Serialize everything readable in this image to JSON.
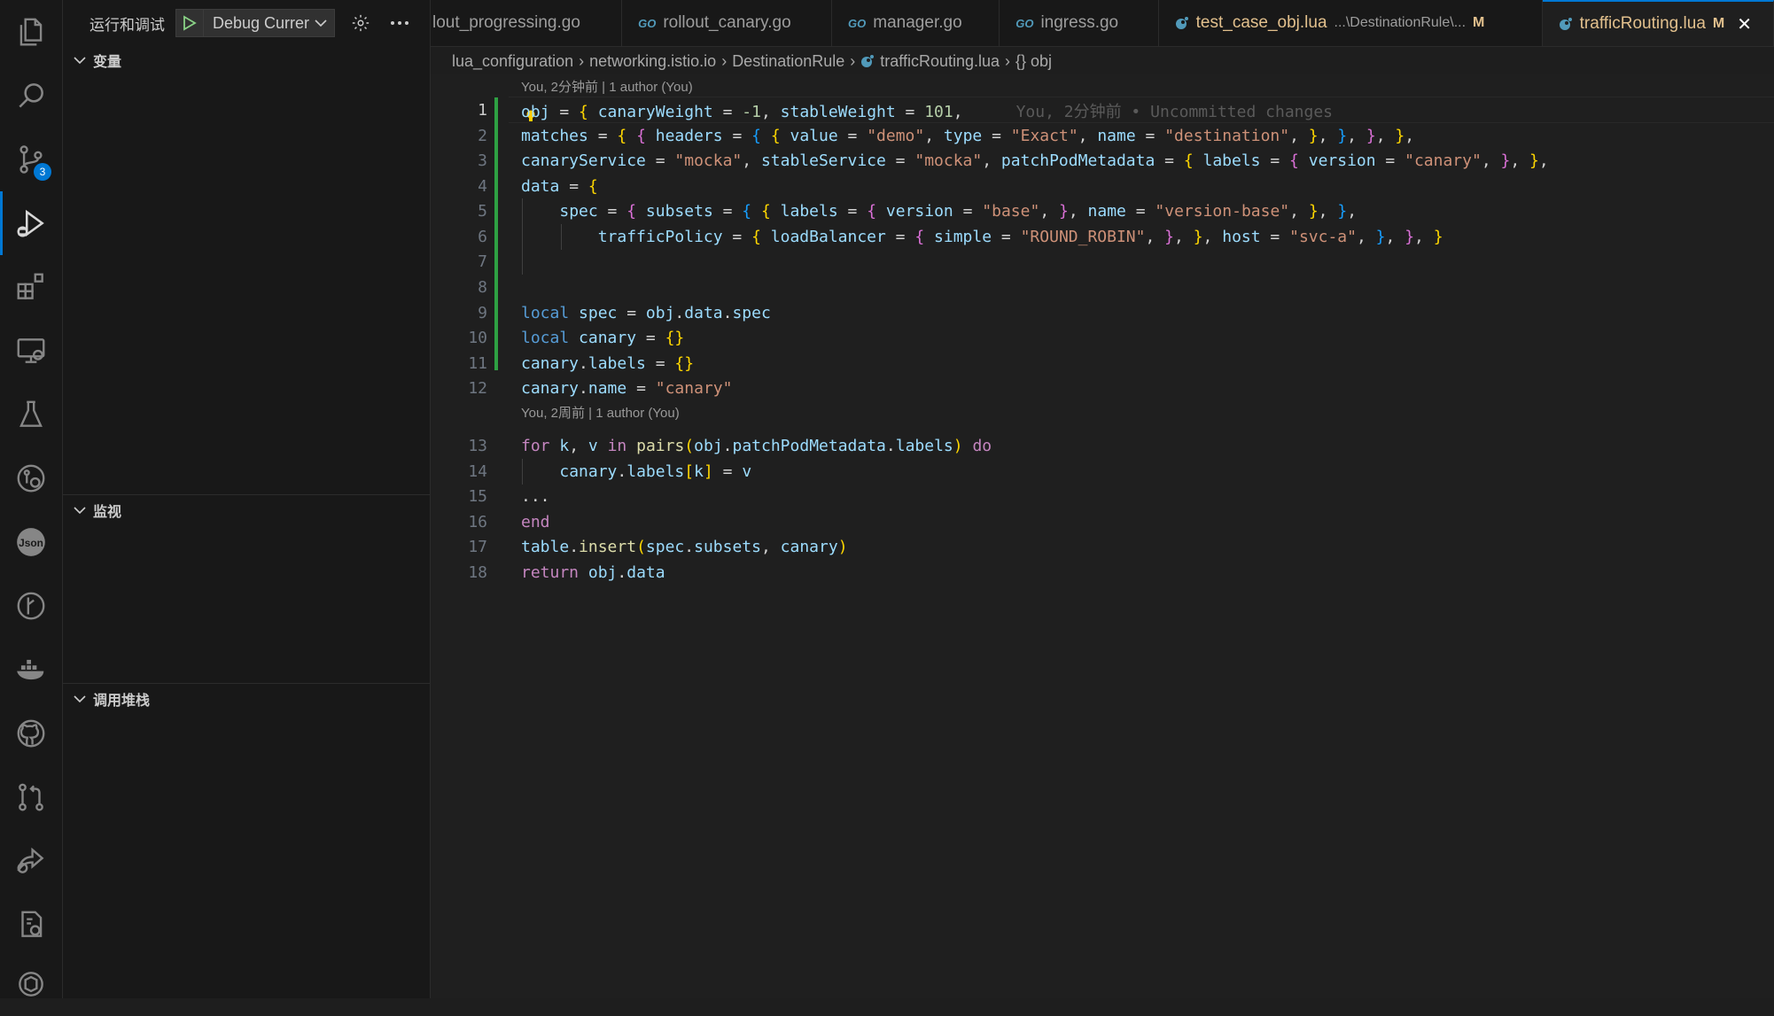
{
  "activity_bar": {
    "items": [
      {
        "icon": "explorer-icon"
      },
      {
        "icon": "search-icon"
      },
      {
        "icon": "source-control-icon",
        "badge": "3"
      },
      {
        "icon": "run-debug-icon",
        "active": true
      },
      {
        "icon": "extensions-icon"
      },
      {
        "icon": "remote-explorer-icon"
      },
      {
        "icon": "testing-icon"
      },
      {
        "icon": "gitlens-icon"
      },
      {
        "icon": "json-icon",
        "label": "Json"
      },
      {
        "icon": "git-graph-icon"
      },
      {
        "icon": "docker-icon"
      },
      {
        "icon": "github-icon"
      },
      {
        "icon": "pull-request-icon"
      },
      {
        "icon": "live-share-icon"
      },
      {
        "icon": "settings-sync-icon"
      },
      {
        "icon": "chatgpt-icon"
      }
    ]
  },
  "sidebar": {
    "title": "运行和调试",
    "config_label": "Debug Currer",
    "sections": {
      "variables": "变量",
      "watch": "监视",
      "call_stack": "调用堆栈"
    }
  },
  "tabs": [
    {
      "label": "lout_progressing.go",
      "kind": "plain"
    },
    {
      "label": "rollout_canary.go",
      "kind": "go"
    },
    {
      "label": "manager.go",
      "kind": "go"
    },
    {
      "label": "ingress.go",
      "kind": "go"
    },
    {
      "label": "test_case_obj.lua",
      "kind": "lua",
      "path": "...\\DestinationRule\\...",
      "modified": "M"
    },
    {
      "label": "trafficRouting.lua",
      "kind": "lua",
      "modified": "M",
      "active": true
    }
  ],
  "breadcrumb": [
    "lua_configuration",
    "networking.istio.io",
    "DestinationRule",
    "trafficRouting.lua",
    "{} obj"
  ],
  "editor": {
    "codelens_1": "You, 2分钟前 | 1 author (You)",
    "codelens_2": "You, 2周前 | 1 author (You)",
    "blame_line_1": "You, 2分钟前 • Uncommitted changes",
    "line_numbers": [
      "1",
      "2",
      "3",
      "4",
      "5",
      "6",
      "7",
      "8",
      "9",
      "10",
      "11",
      "12",
      "13",
      "14",
      "15",
      "16",
      "17",
      "18"
    ],
    "lines": [
      [
        [
          "v",
          "obj"
        ],
        [
          "p",
          " = "
        ],
        [
          "b1",
          "{"
        ],
        [
          "v",
          " canaryWeight"
        ],
        [
          "p",
          " = "
        ],
        [
          "n",
          "-1"
        ],
        [
          "p",
          ", "
        ],
        [
          "v",
          "stableWeight"
        ],
        [
          "p",
          " = "
        ],
        [
          "n",
          "101"
        ],
        [
          "p",
          ","
        ]
      ],
      [
        [
          "v",
          "matches"
        ],
        [
          "p",
          " = "
        ],
        [
          "b1",
          "{"
        ],
        [
          "p",
          " "
        ],
        [
          "b2",
          "{"
        ],
        [
          "p",
          " "
        ],
        [
          "v",
          "headers"
        ],
        [
          "p",
          " = "
        ],
        [
          "b3",
          "{"
        ],
        [
          "p",
          " "
        ],
        [
          "b1",
          "{"
        ],
        [
          "p",
          " "
        ],
        [
          "v",
          "value"
        ],
        [
          "p",
          " = "
        ],
        [
          "s",
          "\"demo\""
        ],
        [
          "p",
          ", "
        ],
        [
          "v",
          "type"
        ],
        [
          "p",
          " = "
        ],
        [
          "s",
          "\"Exact\""
        ],
        [
          "p",
          ", "
        ],
        [
          "v",
          "name"
        ],
        [
          "p",
          " = "
        ],
        [
          "s",
          "\"destination\""
        ],
        [
          "p",
          ", "
        ],
        [
          "b1",
          "}"
        ],
        [
          "p",
          ", "
        ],
        [
          "b3",
          "}"
        ],
        [
          "p",
          ", "
        ],
        [
          "b2",
          "}"
        ],
        [
          "p",
          ", "
        ],
        [
          "b1",
          "}"
        ],
        [
          "p",
          ","
        ]
      ],
      [
        [
          "v",
          "canaryService"
        ],
        [
          "p",
          " = "
        ],
        [
          "s",
          "\"mocka\""
        ],
        [
          "p",
          ", "
        ],
        [
          "v",
          "stableService"
        ],
        [
          "p",
          " = "
        ],
        [
          "s",
          "\"mocka\""
        ],
        [
          "p",
          ", "
        ],
        [
          "v",
          "patchPodMetadata"
        ],
        [
          "p",
          " = "
        ],
        [
          "b1",
          "{"
        ],
        [
          "p",
          " "
        ],
        [
          "v",
          "labels"
        ],
        [
          "p",
          " = "
        ],
        [
          "b2",
          "{"
        ],
        [
          "p",
          " "
        ],
        [
          "v",
          "version"
        ],
        [
          "p",
          " = "
        ],
        [
          "s",
          "\"canary\""
        ],
        [
          "p",
          ", "
        ],
        [
          "b2",
          "}"
        ],
        [
          "p",
          ", "
        ],
        [
          "b1",
          "}"
        ],
        [
          "p",
          ","
        ]
      ],
      [
        [
          "v",
          "data"
        ],
        [
          "p",
          " = "
        ],
        [
          "b1",
          "{"
        ]
      ],
      [
        [
          "p",
          "    "
        ],
        [
          "v",
          "spec"
        ],
        [
          "p",
          " = "
        ],
        [
          "b2",
          "{"
        ],
        [
          "p",
          " "
        ],
        [
          "v",
          "subsets"
        ],
        [
          "p",
          " = "
        ],
        [
          "b3",
          "{"
        ],
        [
          "p",
          " "
        ],
        [
          "b1",
          "{"
        ],
        [
          "p",
          " "
        ],
        [
          "v",
          "labels"
        ],
        [
          "p",
          " = "
        ],
        [
          "b2",
          "{"
        ],
        [
          "p",
          " "
        ],
        [
          "v",
          "version"
        ],
        [
          "p",
          " = "
        ],
        [
          "s",
          "\"base\""
        ],
        [
          "p",
          ", "
        ],
        [
          "b2",
          "}"
        ],
        [
          "p",
          ", "
        ],
        [
          "v",
          "name"
        ],
        [
          "p",
          " = "
        ],
        [
          "s",
          "\"version-base\""
        ],
        [
          "p",
          ", "
        ],
        [
          "b1",
          "}"
        ],
        [
          "p",
          ", "
        ],
        [
          "b3",
          "}"
        ],
        [
          "p",
          ","
        ]
      ],
      [
        [
          "p",
          "        "
        ],
        [
          "v",
          "trafficPolicy"
        ],
        [
          "p",
          " = "
        ],
        [
          "b1",
          "{"
        ],
        [
          "p",
          " "
        ],
        [
          "v",
          "loadBalancer"
        ],
        [
          "p",
          " = "
        ],
        [
          "b2",
          "{"
        ],
        [
          "p",
          " "
        ],
        [
          "v",
          "simple"
        ],
        [
          "p",
          " = "
        ],
        [
          "s",
          "\"ROUND_ROBIN\""
        ],
        [
          "p",
          ", "
        ],
        [
          "b2",
          "}"
        ],
        [
          "p",
          ", "
        ],
        [
          "b1",
          "}"
        ],
        [
          "p",
          ", "
        ],
        [
          "v",
          "host"
        ],
        [
          "p",
          " = "
        ],
        [
          "s",
          "\"svc-a\""
        ],
        [
          "p",
          ", "
        ],
        [
          "b3",
          "}"
        ],
        [
          "p",
          ", "
        ],
        [
          "b2",
          "}"
        ],
        [
          "p",
          ", "
        ],
        [
          "b1",
          "}"
        ]
      ],
      [],
      [],
      [
        [
          "k",
          "local"
        ],
        [
          "p",
          " "
        ],
        [
          "v",
          "spec"
        ],
        [
          "p",
          " = "
        ],
        [
          "v",
          "obj"
        ],
        [
          "p",
          "."
        ],
        [
          "v",
          "data"
        ],
        [
          "p",
          "."
        ],
        [
          "v",
          "spec"
        ]
      ],
      [
        [
          "k",
          "local"
        ],
        [
          "p",
          " "
        ],
        [
          "v",
          "canary"
        ],
        [
          "p",
          " = "
        ],
        [
          "b1",
          "{}"
        ]
      ],
      [
        [
          "v",
          "canary"
        ],
        [
          "p",
          "."
        ],
        [
          "v",
          "labels"
        ],
        [
          "p",
          " = "
        ],
        [
          "b1",
          "{}"
        ]
      ],
      [
        [
          "v",
          "canary"
        ],
        [
          "p",
          "."
        ],
        [
          "v",
          "name"
        ],
        [
          "p",
          " = "
        ],
        [
          "s",
          "\"canary\""
        ]
      ],
      [
        [
          "c",
          "for"
        ],
        [
          "p",
          " "
        ],
        [
          "v",
          "k"
        ],
        [
          "p",
          ", "
        ],
        [
          "v",
          "v"
        ],
        [
          "p",
          " "
        ],
        [
          "c",
          "in"
        ],
        [
          "p",
          " "
        ],
        [
          "f",
          "pairs"
        ],
        [
          "b1",
          "("
        ],
        [
          "v",
          "obj"
        ],
        [
          "p",
          "."
        ],
        [
          "v",
          "patchPodMetadata"
        ],
        [
          "p",
          "."
        ],
        [
          "v",
          "labels"
        ],
        [
          "b1",
          ")"
        ],
        [
          "p",
          " "
        ],
        [
          "c",
          "do"
        ]
      ],
      [
        [
          "p",
          "    "
        ],
        [
          "v",
          "canary"
        ],
        [
          "p",
          "."
        ],
        [
          "v",
          "labels"
        ],
        [
          "b1",
          "["
        ],
        [
          "v",
          "k"
        ],
        [
          "b1",
          "]"
        ],
        [
          "p",
          " = "
        ],
        [
          "v",
          "v"
        ]
      ],
      [
        [
          "p",
          "..."
        ]
      ],
      [
        [
          "c",
          "end"
        ]
      ],
      [
        [
          "v",
          "table"
        ],
        [
          "p",
          "."
        ],
        [
          "f",
          "insert"
        ],
        [
          "b1",
          "("
        ],
        [
          "v",
          "spec"
        ],
        [
          "p",
          "."
        ],
        [
          "v",
          "subsets"
        ],
        [
          "p",
          ", "
        ],
        [
          "v",
          "canary"
        ],
        [
          "b1",
          ")"
        ]
      ],
      [
        [
          "c",
          "return"
        ],
        [
          "p",
          " "
        ],
        [
          "v",
          "obj"
        ],
        [
          "p",
          "."
        ],
        [
          "v",
          "data"
        ]
      ]
    ]
  }
}
